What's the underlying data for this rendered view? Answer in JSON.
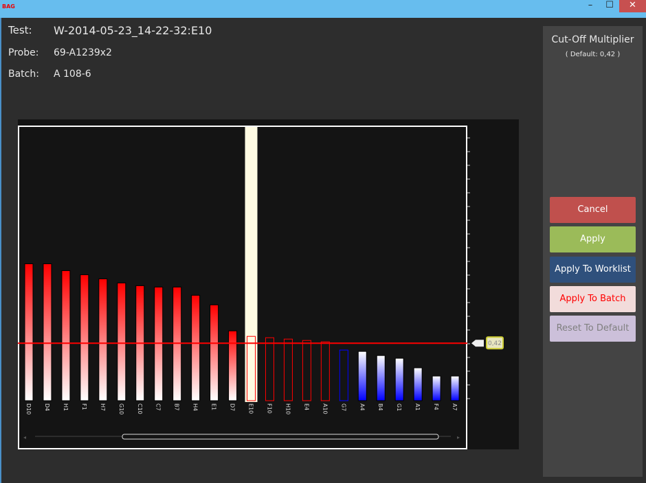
{
  "window": {
    "app_icon_text": "BAG",
    "minimize": "–",
    "maximize": "☐",
    "close": "✕"
  },
  "info": {
    "test_label": "Test:",
    "test_value": "W-2014-05-23_14-22-32:E10",
    "probe_label": "Probe:",
    "probe_value": "69-A1239x2",
    "batch_label": "Batch:",
    "batch_value": "A 108-6"
  },
  "side": {
    "title": "Cut-Off Multiplier",
    "default": "( Default: 0,42 )",
    "buttons": [
      {
        "label": "Cancel",
        "bg": "#c0504d",
        "color": "#ffffff"
      },
      {
        "label": "Apply",
        "bg": "#9bbb59",
        "color": "#ffffff"
      },
      {
        "label": "Apply To Worklist",
        "bg": "#2f507c",
        "color": "#ffffff"
      },
      {
        "label": "Apply To Batch",
        "bg": "#f2dcdb",
        "color": "#ff0000"
      },
      {
        "label": "Reset To Default",
        "bg": "#ccc0da",
        "color": "#7f7f7f"
      }
    ]
  },
  "chart_data": {
    "type": "bar",
    "ylim": [
      0,
      2.0
    ],
    "cutoff": 0.42,
    "cutoff_label": "0,42",
    "cutoff_color": "#ff0000",
    "selected": "E10",
    "categories": [
      "D10",
      "D4",
      "H1",
      "F1",
      "H7",
      "G10",
      "C10",
      "C7",
      "B7",
      "H4",
      "E1",
      "D7",
      "E10",
      "F10",
      "H10",
      "E4",
      "A10",
      "G7",
      "A4",
      "B4",
      "G1",
      "A1",
      "F4",
      "A7"
    ],
    "values": [
      1.0,
      1.0,
      0.95,
      0.92,
      0.89,
      0.86,
      0.84,
      0.83,
      0.83,
      0.77,
      0.7,
      0.51,
      0.47,
      0.46,
      0.45,
      0.44,
      0.43,
      0.37,
      0.36,
      0.33,
      0.31,
      0.24,
      0.18,
      0.18
    ],
    "styles": [
      "positive",
      "positive",
      "positive",
      "positive",
      "positive",
      "positive",
      "positive",
      "positive",
      "positive",
      "positive",
      "positive",
      "positive",
      "outline-red",
      "outline-red",
      "outline-red",
      "outline-red",
      "outline-red",
      "outline-blue",
      "negative",
      "negative",
      "negative",
      "negative",
      "negative",
      "negative"
    ]
  }
}
